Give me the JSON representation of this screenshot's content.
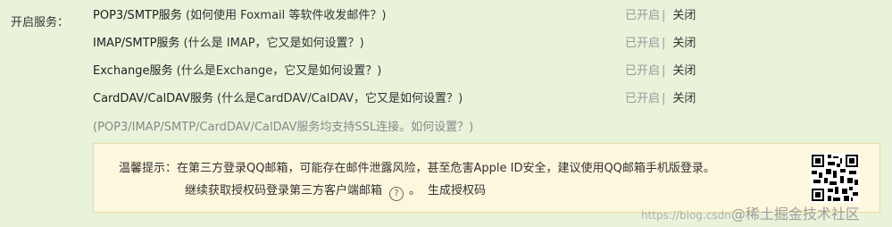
{
  "section": {
    "label": "开启服务："
  },
  "services": [
    {
      "name": "POP3/SMTP服务",
      "open_paren": " (",
      "help_text": "如何使用 Foxmail 等软件收发邮件？",
      "close_paren": ")",
      "status_on": "已开启",
      "separator": "|",
      "status_off": "关闭"
    },
    {
      "name": "IMAP/SMTP服务",
      "open_paren": " (",
      "help_text": "什么是 IMAP，它又是如何设置？",
      "close_paren": ")",
      "status_on": "已开启",
      "separator": "|",
      "status_off": "关闭"
    },
    {
      "name": "Exchange服务",
      "open_paren": " (",
      "help_text": "什么是Exchange，它又是如何设置？",
      "close_paren": ")",
      "status_on": "已开启",
      "separator": "|",
      "status_off": "关闭"
    },
    {
      "name": "CardDAV/CalDAV服务",
      "open_paren": " (",
      "help_text": "什么是CardDAV/CalDAV，它又是如何设置？",
      "close_paren": ")",
      "status_on": "已开启",
      "separator": "|",
      "status_off": "关闭"
    }
  ],
  "ssl_note": "(POP3/IMAP/SMTP/CardDAV/CalDAV服务均支持SSL连接。如何设置？)",
  "tip": {
    "line1": "温馨提示：在第三方登录QQ邮箱，可能存在邮件泄露风险，甚至危害Apple ID安全，建议使用QQ邮箱手机版登录。",
    "line2_prefix": "继续获取授权码登录第三方客户端邮箱",
    "help_glyph": "?",
    "line2_suffix": "。",
    "generate_label": "生成授权码"
  },
  "watermark": {
    "url": "https://blog.csdn",
    "brand": "@稀土掘金技术社区"
  },
  "colors": {
    "background": "#e8f3da",
    "tip_background": "#fdf7dd",
    "tip_border": "#eadca0",
    "muted_text": "#999999"
  },
  "icons": {
    "help": "help-circle-icon",
    "qr": "qr-code-icon"
  }
}
